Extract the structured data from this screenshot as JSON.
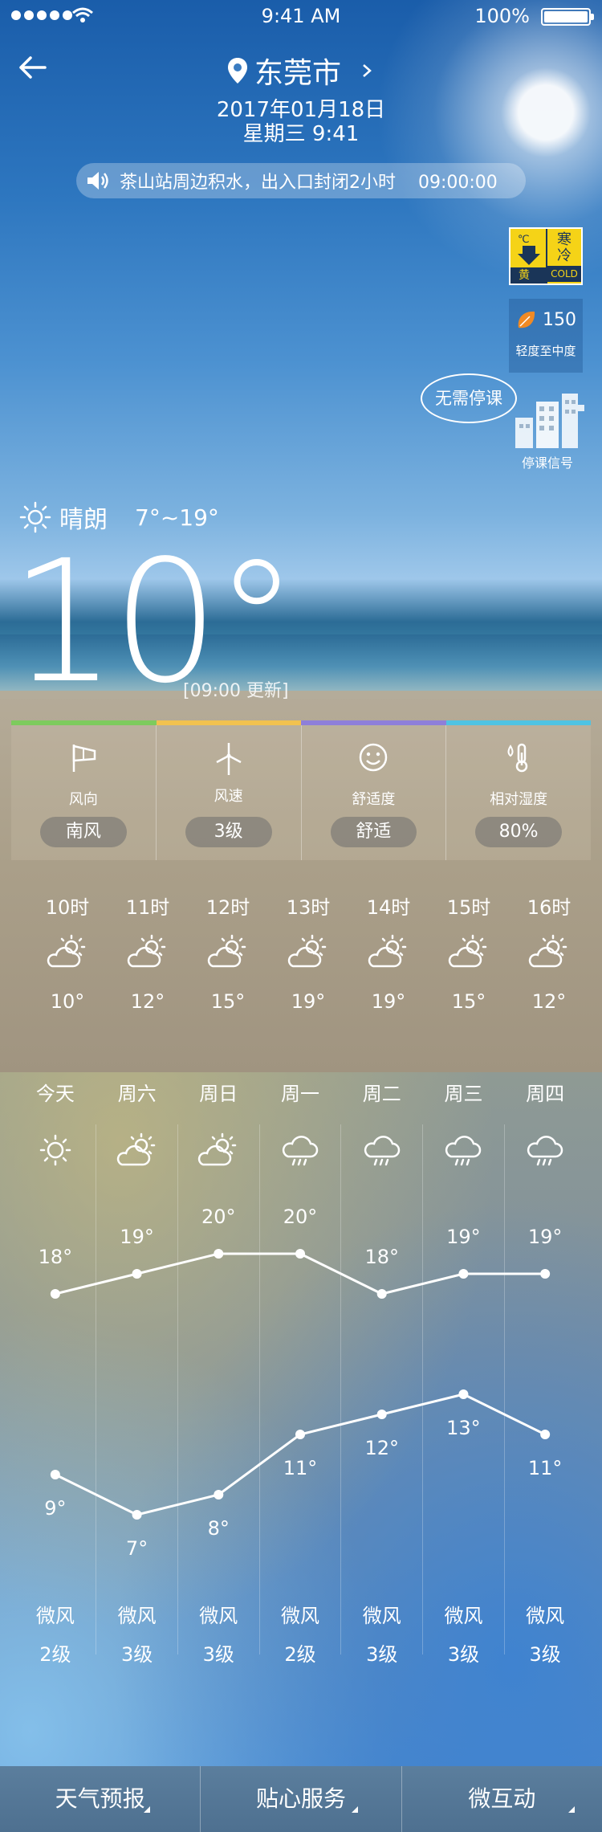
{
  "status": {
    "time": "9:41 AM",
    "battery": "100%"
  },
  "header": {
    "city": "东莞市",
    "date": "2017年01月18日",
    "weekday_time": "星期三 9:41",
    "alert": "茶山站周边积水，出入口封闭2小时    09:00:00"
  },
  "widgets": {
    "cold_warning": {
      "line1": "寒",
      "line2": "冷",
      "level": "黄",
      "code": "COLD"
    },
    "aqi": {
      "value": "150",
      "level": "轻度至中度"
    },
    "school": {
      "bubble": "无需停课",
      "label": "停课信号"
    }
  },
  "current": {
    "condition": "晴朗",
    "range": "7°~19°",
    "temp": "10°",
    "updated": "[09:00 更新]"
  },
  "colors": {
    "bar": [
      "#7dcb5d",
      "#f2c24f",
      "#8e7fd9",
      "#4fc3e3"
    ]
  },
  "metrics": [
    {
      "label": "风向",
      "value": "南风",
      "icon": "wind-flag-icon"
    },
    {
      "label": "风速",
      "value": "3级",
      "icon": "wind-turbine-icon"
    },
    {
      "label": "舒适度",
      "value": "舒适",
      "icon": "smiley-icon"
    },
    {
      "label": "相对湿度",
      "value": "80%",
      "icon": "thermometer-drop-icon"
    }
  ],
  "hourly": [
    {
      "time": "10时",
      "temp": "10°",
      "icon": "partly-cloudy-icon"
    },
    {
      "time": "11时",
      "temp": "12°",
      "icon": "partly-cloudy-icon"
    },
    {
      "time": "12时",
      "temp": "15°",
      "icon": "partly-cloudy-icon"
    },
    {
      "time": "13时",
      "temp": "19°",
      "icon": "partly-cloudy-icon"
    },
    {
      "time": "14时",
      "temp": "19°",
      "icon": "partly-cloudy-icon"
    },
    {
      "time": "15时",
      "temp": "15°",
      "icon": "partly-cloudy-icon"
    },
    {
      "time": "16时",
      "temp": "12°",
      "icon": "partly-cloudy-icon"
    }
  ],
  "chart_data": {
    "type": "line",
    "categories": [
      "今天",
      "周六",
      "周日",
      "周一",
      "周二",
      "周三",
      "周四"
    ],
    "series": [
      {
        "values": [
          18,
          19,
          20,
          20,
          18,
          19,
          19
        ]
      },
      {
        "values": [
          9,
          7,
          8,
          11,
          12,
          13,
          11
        ]
      }
    ],
    "high_labels": [
      "18°",
      "19°",
      "20°",
      "20°",
      "18°",
      "19°",
      "19°"
    ],
    "low_labels": [
      "9°",
      "7°",
      "8°",
      "11°",
      "12°",
      "13°",
      "11°"
    ],
    "icons": [
      "sun-icon",
      "partly-cloudy-icon",
      "partly-cloudy-icon",
      "rain-cloud-icon",
      "rain-cloud-icon",
      "rain-cloud-icon",
      "rain-cloud-icon"
    ]
  },
  "daily_wind": {
    "dir": [
      "微风",
      "微风",
      "微风",
      "微风",
      "微风",
      "微风",
      "微风"
    ],
    "level": [
      "2级",
      "3级",
      "3级",
      "2级",
      "3级",
      "3级",
      "3级"
    ]
  },
  "tabs": [
    "天气预报",
    "贴心服务",
    "微互动"
  ]
}
